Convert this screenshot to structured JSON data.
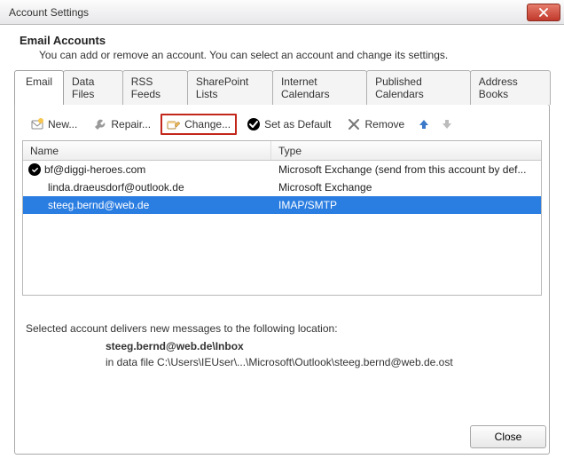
{
  "window": {
    "title": "Account Settings"
  },
  "header": {
    "title": "Email Accounts",
    "subtitle": "You can add or remove an account. You can select an account and change its settings."
  },
  "tabs": [
    {
      "label": "Email",
      "active": true
    },
    {
      "label": "Data Files"
    },
    {
      "label": "RSS Feeds"
    },
    {
      "label": "SharePoint Lists"
    },
    {
      "label": "Internet Calendars"
    },
    {
      "label": "Published Calendars"
    },
    {
      "label": "Address Books"
    }
  ],
  "toolbar": {
    "new": "New...",
    "repair": "Repair...",
    "change": "Change...",
    "default": "Set as Default",
    "remove": "Remove"
  },
  "columns": {
    "name": "Name",
    "type": "Type"
  },
  "accounts": [
    {
      "name": "bf@diggi-heroes.com",
      "type": "Microsoft Exchange (send from this account by def...",
      "default": true
    },
    {
      "name": "linda.draeusdorf@outlook.de",
      "type": "Microsoft Exchange"
    },
    {
      "name": "steeg.bernd@web.de",
      "type": "IMAP/SMTP",
      "selected": true
    }
  ],
  "location": {
    "intro": "Selected account delivers new messages to the following location:",
    "folder": "steeg.bernd@web.de\\Inbox",
    "file": "in data file C:\\Users\\IEUser\\...\\Microsoft\\Outlook\\steeg.bernd@web.de.ost"
  },
  "buttons": {
    "close": "Close"
  }
}
